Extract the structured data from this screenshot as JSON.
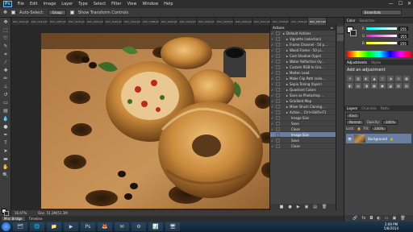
{
  "app": {
    "logo": "Ps"
  },
  "menu": [
    "File",
    "Edit",
    "Image",
    "Layer",
    "Type",
    "Select",
    "Filter",
    "View",
    "Window",
    "Help"
  ],
  "window_controls": [
    "—",
    "☐",
    "✕"
  ],
  "options_bar": {
    "auto_select_label": "Auto-Select:",
    "auto_select_value": "Group",
    "show_transform_label": "Show Transform Controls",
    "workspace": "Essentials"
  },
  "doc_tabs": [
    "DSC_0001.JPG",
    "DSC_0012.JPG",
    "DSC_0087.JPG",
    "DSC_0193.JPG",
    "DSC_0201.JPG",
    "DSC_0245.JPG",
    "DSC_0310.JPG",
    "DSC_0388.JPG",
    "DSC_0402.JPG",
    "DSC_0419.JPG",
    "DSC_0455.JPG",
    "DSC_0478.JPG",
    "DSC_0491.JPG",
    "DSC_0512.JPG",
    "DSC_0538.JPG",
    "DSC_0556.JPG",
    "DSC_0571.JPG"
  ],
  "status": {
    "zoom": "16.67%",
    "doc": "Doc: 51.3M/51.3M"
  },
  "bottom_tabs": [
    "Mini Bridge",
    "Timeline"
  ],
  "actions_panel": {
    "title": "Actions",
    "items": [
      {
        "label": "Default Actions",
        "indent": 0,
        "selected": false
      },
      {
        "label": "Vignette (selection)",
        "indent": 1,
        "selected": false
      },
      {
        "label": "Frame Channel - 50 p...",
        "indent": 1,
        "selected": false
      },
      {
        "label": "Wood Frame - 50 pi...",
        "indent": 1,
        "selected": false
      },
      {
        "label": "Cast Shadow (type)",
        "indent": 1,
        "selected": false
      },
      {
        "label": "Water Reflection (ty...",
        "indent": 1,
        "selected": false
      },
      {
        "label": "Custom RGB to Gra...",
        "indent": 1,
        "selected": false
      },
      {
        "label": "Molten Lead",
        "indent": 1,
        "selected": false
      },
      {
        "label": "Make Clip Path (sele...",
        "indent": 1,
        "selected": false
      },
      {
        "label": "Sepia Toning (layer)",
        "indent": 1,
        "selected": false
      },
      {
        "label": "Quadrant Colors",
        "indent": 1,
        "selected": false
      },
      {
        "label": "Save as Photoshop ...",
        "indent": 1,
        "selected": false
      },
      {
        "label": "Gradient Map",
        "indent": 1,
        "selected": false
      },
      {
        "label": "Mixer Brush Cloning...",
        "indent": 1,
        "selected": false
      },
      {
        "label": "Action...     Ctrl+Shift+F1",
        "indent": 1,
        "selected": false
      },
      {
        "label": "Image Size",
        "indent": 2,
        "selected": false
      },
      {
        "label": "Save",
        "indent": 2,
        "selected": false
      },
      {
        "label": "Close",
        "indent": 2,
        "selected": false
      },
      {
        "label": "Image Size",
        "indent": 2,
        "selected": true
      },
      {
        "label": "Save",
        "indent": 2,
        "selected": false
      },
      {
        "label": "Close",
        "indent": 2,
        "selected": false
      }
    ],
    "footer_icons": [
      "■",
      "●",
      "▶",
      "▣",
      "▤",
      "🗑"
    ]
  },
  "color_panel": {
    "tabs": [
      "Color",
      "Swatches"
    ],
    "r": "255",
    "g": "255",
    "b": "255"
  },
  "adjustments_panel": {
    "tabs": [
      "Adjustments",
      "Styles"
    ],
    "title": "Add an adjustment",
    "icons": [
      "☀",
      "▥",
      "◐",
      "▲",
      "▽",
      "◑",
      "⚖",
      "▦",
      "◧",
      "▤",
      "◨",
      "▩",
      "▣",
      "◪",
      "▧",
      "▨"
    ]
  },
  "layers_panel": {
    "tabs": [
      "Layers",
      "Channels",
      "Paths"
    ],
    "kind": "Kind",
    "blend": "Normal",
    "opacity_label": "Opacity:",
    "opacity": "100%",
    "lock_label": "Lock:",
    "fill_label": "Fill:",
    "fill": "100%",
    "layer_name": "Background"
  },
  "taskbar": {
    "apps": [
      "🗂",
      "🌐",
      "📁",
      "▶",
      "Ps",
      "🦊",
      "✉",
      "⚙",
      "📊",
      "🖥"
    ],
    "time": "2:09 PM",
    "date": "5/8/2014"
  }
}
